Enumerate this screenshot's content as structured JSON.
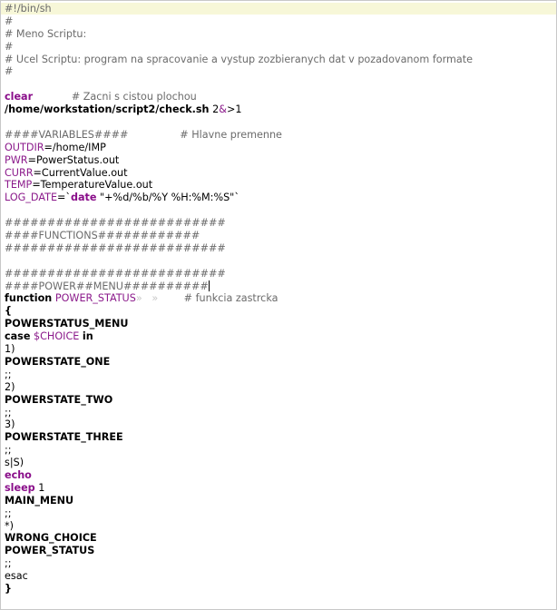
{
  "editor": {
    "lines": [
      {
        "parts": [
          {
            "t": "#!/bin/sh",
            "c": "c"
          }
        ]
      },
      {
        "parts": [
          {
            "t": "#",
            "c": "c"
          }
        ]
      },
      {
        "parts": [
          {
            "t": "# Meno Scriptu:",
            "c": "c"
          }
        ]
      },
      {
        "parts": [
          {
            "t": "#",
            "c": "c"
          }
        ]
      },
      {
        "parts": [
          {
            "t": "# Ucel Scriptu: program na spracovanie a vystup zozbieranych dat v pozadovanom formate",
            "c": "c"
          }
        ]
      },
      {
        "parts": [
          {
            "t": "#",
            "c": "c"
          }
        ]
      },
      {
        "parts": []
      },
      {
        "parts": [
          {
            "t": "clear",
            "c": "kw"
          },
          {
            "t": "            ",
            "c": ""
          },
          {
            "t": "# Zacni s cistou plochou",
            "c": "c"
          }
        ]
      },
      {
        "parts": [
          {
            "t": "/home/workstation/script2/check.sh",
            "c": "b"
          },
          {
            "t": " 2",
            "c": ""
          },
          {
            "t": "&",
            "c": "v"
          },
          {
            "t": ">1",
            "c": ""
          }
        ]
      },
      {
        "parts": []
      },
      {
        "parts": [
          {
            "t": "####VARIABLES####",
            "c": "c"
          },
          {
            "t": "                ",
            "c": ""
          },
          {
            "t": "# Hlavne premenne",
            "c": "c"
          }
        ]
      },
      {
        "parts": [
          {
            "t": "OUTDIR",
            "c": "v"
          },
          {
            "t": "=/home/IMP",
            "c": ""
          }
        ]
      },
      {
        "parts": [
          {
            "t": "PWR",
            "c": "v"
          },
          {
            "t": "=PowerStatus.out",
            "c": ""
          }
        ]
      },
      {
        "parts": [
          {
            "t": "CURR",
            "c": "v"
          },
          {
            "t": "=CurrentValue.out",
            "c": ""
          }
        ]
      },
      {
        "parts": [
          {
            "t": "TEMP",
            "c": "v"
          },
          {
            "t": "=TemperatureValue.out",
            "c": ""
          }
        ]
      },
      {
        "parts": [
          {
            "t": "LOG_DATE",
            "c": "v"
          },
          {
            "t": "=`",
            "c": ""
          },
          {
            "t": "date",
            "c": "kw"
          },
          {
            "t": " \"+%d/%b/%Y %H:%M:%S\"`",
            "c": ""
          }
        ]
      },
      {
        "parts": []
      },
      {
        "parts": [
          {
            "t": "##########################",
            "c": "c"
          }
        ]
      },
      {
        "parts": [
          {
            "t": "####FUNCTIONS############",
            "c": "c"
          }
        ]
      },
      {
        "parts": [
          {
            "t": "##########################",
            "c": "c"
          }
        ]
      },
      {
        "parts": []
      },
      {
        "parts": [
          {
            "t": "##########################",
            "c": "c"
          }
        ]
      },
      {
        "parts": [
          {
            "t": "####POWER##MENU##########",
            "c": "c"
          },
          {
            "t": "",
            "c": "cursor"
          }
        ]
      },
      {
        "parts": [
          {
            "t": "function",
            "c": "b"
          },
          {
            "t": " ",
            "c": ""
          },
          {
            "t": "POWER_STATUS",
            "c": "v"
          },
          {
            "t": "»   »",
            "c": "ws"
          },
          {
            "t": "        ",
            "c": ""
          },
          {
            "t": "# funkcia zastrcka",
            "c": "c"
          }
        ]
      },
      {
        "parts": [
          {
            "t": "{",
            "c": "b"
          }
        ]
      },
      {
        "parts": [
          {
            "t": "POWERSTATUS_MENU",
            "c": "b"
          }
        ]
      },
      {
        "parts": [
          {
            "t": "case",
            "c": "b"
          },
          {
            "t": " ",
            "c": ""
          },
          {
            "t": "$CHOICE",
            "c": "v"
          },
          {
            "t": " ",
            "c": ""
          },
          {
            "t": "in",
            "c": "b"
          }
        ]
      },
      {
        "parts": [
          {
            "t": "1)",
            "c": ""
          }
        ]
      },
      {
        "parts": [
          {
            "t": "POWERSTATE_ONE",
            "c": "b"
          }
        ]
      },
      {
        "parts": [
          {
            "t": ";;",
            "c": ""
          }
        ]
      },
      {
        "parts": [
          {
            "t": "2)",
            "c": ""
          }
        ]
      },
      {
        "parts": [
          {
            "t": "POWERSTATE_TWO",
            "c": "b"
          }
        ]
      },
      {
        "parts": [
          {
            "t": ";;",
            "c": ""
          }
        ]
      },
      {
        "parts": [
          {
            "t": "3)",
            "c": ""
          }
        ]
      },
      {
        "parts": [
          {
            "t": "POWERSTATE_THREE",
            "c": "b"
          }
        ]
      },
      {
        "parts": [
          {
            "t": ";;",
            "c": ""
          }
        ]
      },
      {
        "parts": [
          {
            "t": "s|S)",
            "c": ""
          }
        ]
      },
      {
        "parts": [
          {
            "t": "echo",
            "c": "kw"
          }
        ]
      },
      {
        "parts": [
          {
            "t": "sleep",
            "c": "kw"
          },
          {
            "t": " 1",
            "c": ""
          }
        ]
      },
      {
        "parts": [
          {
            "t": "MAIN_MENU",
            "c": "b"
          }
        ]
      },
      {
        "parts": [
          {
            "t": ";;",
            "c": ""
          }
        ]
      },
      {
        "parts": [
          {
            "t": "*)",
            "c": ""
          }
        ]
      },
      {
        "parts": [
          {
            "t": "WRONG_CHOICE",
            "c": "b"
          }
        ]
      },
      {
        "parts": [
          {
            "t": "POWER_STATUS",
            "c": "b"
          }
        ]
      },
      {
        "parts": [
          {
            "t": ";;",
            "c": ""
          }
        ]
      },
      {
        "parts": [
          {
            "t": "esac",
            "c": ""
          }
        ]
      },
      {
        "parts": [
          {
            "t": "}",
            "c": "b"
          }
        ]
      }
    ],
    "colors": {
      "comment": "#6b6b6b",
      "keyword": "#8a0e8a",
      "variable": "#8b1a8b",
      "current_line": "#f7f7d8"
    }
  }
}
